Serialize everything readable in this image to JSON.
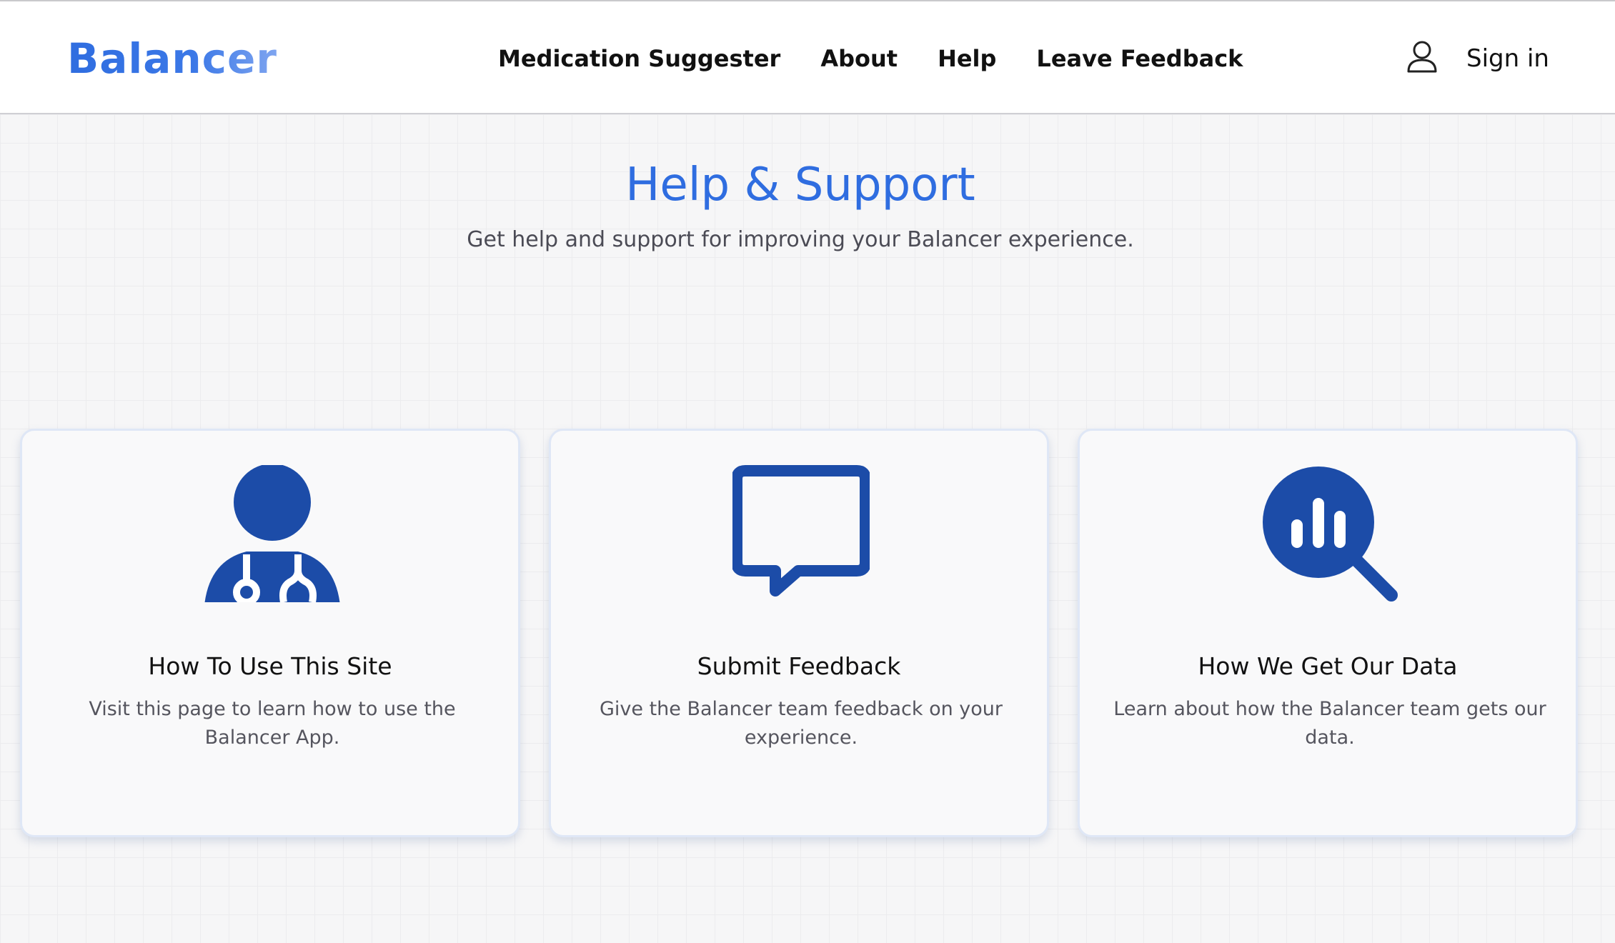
{
  "brand": {
    "name": "Balancer",
    "color": "#2f6de0"
  },
  "nav": {
    "items": [
      {
        "label": "Medication Suggester"
      },
      {
        "label": "About"
      },
      {
        "label": "Help"
      },
      {
        "label": "Leave Feedback"
      }
    ],
    "sign_in_label": "Sign in",
    "user_icon": "user-icon"
  },
  "hero": {
    "title": "Help & Support",
    "subtitle": "Get help and support for improving your Balancer experience."
  },
  "cards": [
    {
      "icon": "doctor-stethoscope-icon",
      "title": "How To Use This Site",
      "description": "Visit this page to learn how to use the Balancer App."
    },
    {
      "icon": "speech-bubble-icon",
      "title": "Submit Feedback",
      "description": "Give the Balancer team feedback on your experience."
    },
    {
      "icon": "data-search-icon",
      "title": "How We Get Our Data",
      "description": "Learn about how the Balancer team gets our data."
    }
  ],
  "colors": {
    "icon": "#1c4ca8",
    "accent": "#2f6de0"
  }
}
